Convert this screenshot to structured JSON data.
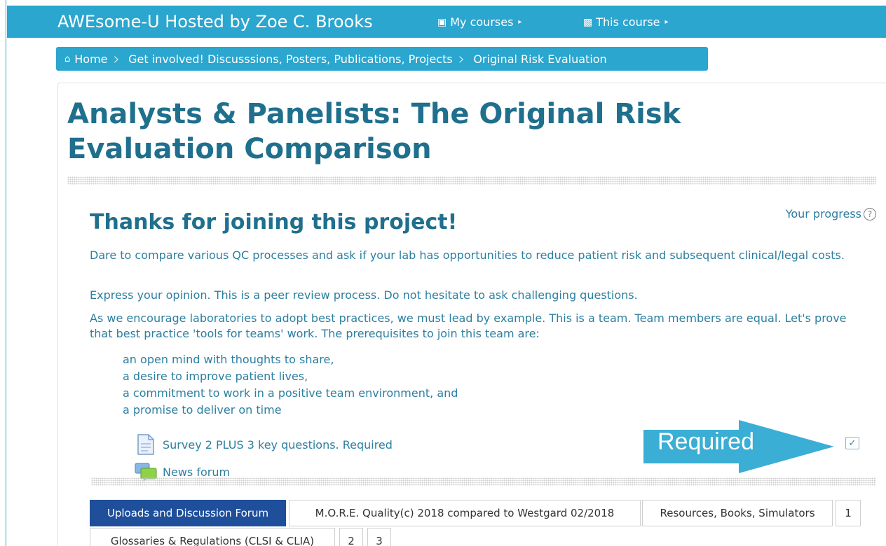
{
  "navbar": {
    "brand": "AWEsome-U Hosted by Zoe C. Brooks",
    "my_courses": "My courses",
    "this_course": "This course"
  },
  "breadcrumb": [
    "Home",
    "Get involved! Discusssions, Posters, Publications, Projects",
    "Original Risk Evaluation"
  ],
  "page": {
    "title": "Analysts & Panelists: The Original Risk Evaluation Comparison",
    "section_title": "Thanks for joining this project!",
    "progress_label": "Your progress",
    "paragraphs": [
      "Dare to compare various QC processes and ask if your lab has opportunities to reduce patient risk and subsequent clinical/legal costs.",
      "Express your opinion.  This is a peer review process.  Do not hesitate to ask challenging questions.",
      "As we encourage laboratories to adopt best practices, we must lead by example. This is a team.  Team members are equal.   Let's prove that best practice 'tools for teams' work.  The prerequisites to join this team are:"
    ],
    "prerequisites": [
      "an open mind with thoughts to share,",
      "a desire to improve patient lives,",
      "a commitment to work in a positive team environment, and",
      "a promise to deliver on time"
    ]
  },
  "activities": [
    {
      "label": "Survey 2 PLUS 3 key questions. Required",
      "icon": "document-icon"
    },
    {
      "label": "News forum",
      "icon": "forum-icon"
    }
  ],
  "annotation": {
    "text": "Required"
  },
  "tabs": [
    {
      "label": "Uploads and Discussion Forum",
      "active": true
    },
    {
      "label": "M.O.R.E. Quality(c) 2018 compared to Westgard 02/2018",
      "active": false
    },
    {
      "label": "Resources, Books, Simulators",
      "active": false
    },
    {
      "label": "1",
      "active": false
    },
    {
      "label": "Glossaries & Regulations (CLSI & CLIA)",
      "active": false
    },
    {
      "label": "2",
      "active": false
    },
    {
      "label": "3",
      "active": false
    }
  ],
  "colors": {
    "nav": "#2aa6cf",
    "heading": "#1f6f8d",
    "text": "#2b7fa0",
    "active_tab": "#1f4f9a"
  }
}
